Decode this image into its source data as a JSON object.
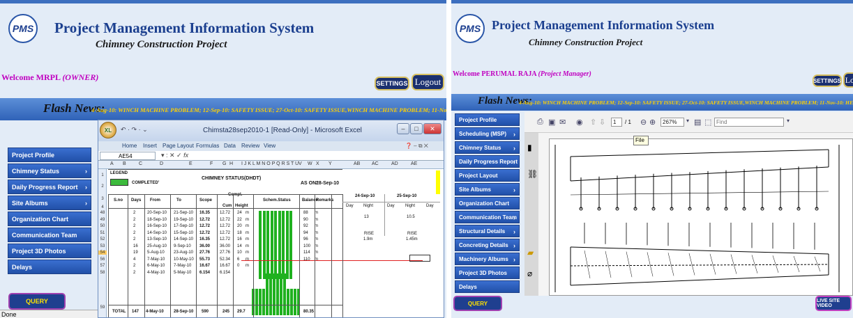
{
  "left": {
    "logo": "PMS",
    "title": "Project Management Information System",
    "subtitle": "Chimney Construction Project",
    "welcome_name": "Welcome MRPL",
    "welcome_role": "(OWNER)",
    "settings": "SETTINGS",
    "logout": "Logout",
    "flash_label": "Flash News:",
    "flash_text": "4-Aug-10: WINCH MACHINE PROBLEM; 12-Sep-10: SAFETY ISSUE; 27-Oct-10: SAFETY ISSUE,WINCH MACHINE PROBLEM; 11-Nov-10: HEAVY RAIN (PROGRESS HAM",
    "menu": [
      "Project Profile",
      "Chimney Status",
      "Daily Progress Report",
      "Site Albums",
      "Organization Chart",
      "Communication Team",
      "Project 3D Photos",
      "Delays"
    ],
    "query": "QUERY",
    "status": "Done",
    "excel": {
      "title": "Chimsta28sep2010-1  [Read-Only] - Microsoft Excel",
      "tabs": [
        "Home",
        "Insert",
        "Page Layout",
        "Formulas",
        "Data",
        "Review",
        "View"
      ],
      "namebox": "AE54",
      "fx": "fx",
      "cols": [
        "A",
        "B",
        "C",
        "D",
        "E",
        "F",
        "G",
        "H",
        "I J K L M N O P Q R S T U",
        "V",
        "W",
        "X",
        "Y",
        "AB",
        "AC",
        "AD",
        "AE"
      ],
      "legend": "LEGEND",
      "completed": "COMPLETED'",
      "sheet_title": "CHIMNEY STATUS(DHDT)",
      "as_on_label": "AS ON:",
      "as_on_date": "28-Sep-10",
      "headers": {
        "sno": "S.no",
        "days": "Days",
        "from": "From",
        "to": "To",
        "scope": "Scope",
        "compl": "Compl.",
        "cum": "Cum",
        "height": "Height",
        "schem": "Schem.Status",
        "balance": "Balance",
        "remarks": "Remarks"
      },
      "date1": "24-Sep-10",
      "date2": "25-Sep-10",
      "day": "Day",
      "night": "Night",
      "d1_night": "13",
      "d2_night": "10.5",
      "rise": "RISE",
      "rise1": "1.9m",
      "rise2": "1.45m",
      "rows": [
        {
          "r": "48",
          "days": "2",
          "from": "20-Sep-10",
          "to": "21-Sep-10",
          "scope": "16.35",
          "cum": "12.72",
          "h": "24",
          "hu": "m",
          "bal": "88",
          "bu": "m"
        },
        {
          "r": "49",
          "days": "2",
          "from": "18-Sep-10",
          "to": "19-Sep-10",
          "scope": "12.72",
          "cum": "12.72",
          "h": "22",
          "hu": "m",
          "bal": "90",
          "bu": "m"
        },
        {
          "r": "50",
          "days": "2",
          "from": "16-Sep-10",
          "to": "17-Sep-10",
          "scope": "12.72",
          "cum": "12.72",
          "h": "20",
          "hu": "m",
          "bal": "92",
          "bu": "m"
        },
        {
          "r": "51",
          "days": "2",
          "from": "14-Sep-10",
          "to": "15-Sep-10",
          "scope": "12.72",
          "cum": "12.72",
          "h": "18",
          "hu": "m",
          "bal": "94",
          "bu": "m"
        },
        {
          "r": "52",
          "days": "2",
          "from": "13-Sep-10",
          "to": "14-Sep-10",
          "scope": "16.35",
          "cum": "12.72",
          "h": "16",
          "hu": "m",
          "bal": "96",
          "bu": "m"
        },
        {
          "r": "53",
          "days": "16",
          "from": "25-Aug-10",
          "to": "9-Sep-10",
          "scope": "36.00",
          "cum": "36.00",
          "h": "14",
          "hu": "m",
          "bal": "100",
          "bu": "m"
        },
        {
          "r": "54",
          "days": "19",
          "from": "5-Aug-10",
          "to": "23-Aug-10",
          "scope": "27.76",
          "cum": "27.76",
          "h": "10",
          "hu": "m",
          "bal": "114",
          "bu": "m"
        },
        {
          "r": "56",
          "days": "4",
          "from": "7-May-10",
          "to": "10-May-10",
          "scope": "55.73",
          "cum": "52.34",
          "h": "6",
          "hu": "m",
          "bal": "110",
          "bu": "m"
        },
        {
          "r": "57",
          "days": "2",
          "from": "6-May-10",
          "to": "7-May-10",
          "scope": "16.67",
          "cum": "16.67",
          "h": "0",
          "hu": "m",
          "bal": "",
          "bu": ""
        },
        {
          "r": "58",
          "days": "2",
          "from": "4-May-10",
          "to": "5-May-10",
          "scope": "6.154",
          "cum": "6.154",
          "h": "",
          "hu": "",
          "bal": "",
          "bu": ""
        }
      ],
      "total": {
        "r": "59",
        "label": "TOTAL",
        "days": "147",
        "from": "4-May-10",
        "to": "28-Sep-10",
        "scope": "590",
        "cum": "245",
        "h": "29.7",
        "bal": "80.35"
      }
    }
  },
  "right": {
    "logo": "PMS",
    "title": "Project Management Information System",
    "subtitle": "Chimney Construction Project",
    "welcome_name": "Welcome PERUMAL RAJA",
    "welcome_role": "(Project Manager)",
    "settings": "SETTINGS",
    "logout": "Logout",
    "flash_label": "Flash News:",
    "flash_text": "4-Aug-10: WINCH MACHINE PROBLEM; 12-Sep-10: SAFETY ISSUE; 27-Oct-10: SAFETY ISSUE,WINCH MACHINE PROBLEM; 11-Nov-10: HEAVY RA",
    "menu": [
      "Project Profile",
      "Scheduling (MSP)",
      "Chimney Status",
      "Daily Progress Report",
      "Project Layout",
      "Site Albums",
      "Organization Chart",
      "Communication Team",
      "Structural Details",
      "Concreting Details",
      "Machinery Albums",
      "Project 3D Photos",
      "Delays"
    ],
    "menu_chevrons": [
      false,
      true,
      true,
      true,
      false,
      true,
      false,
      true,
      true,
      true,
      true,
      false,
      false
    ],
    "query": "QUERY",
    "live": "LIVE SITE VIDEO",
    "pdf": {
      "page": "1",
      "pages": "/ 1",
      "zoom": "267%",
      "find": "Find",
      "tooltip": "File"
    }
  },
  "colors": {
    "banner": "#3d6fbf",
    "accent_text": "#c000c0",
    "flash_text": "#ffd000",
    "menu": "#2a5cc0",
    "progress_green": "#1fb11f"
  }
}
